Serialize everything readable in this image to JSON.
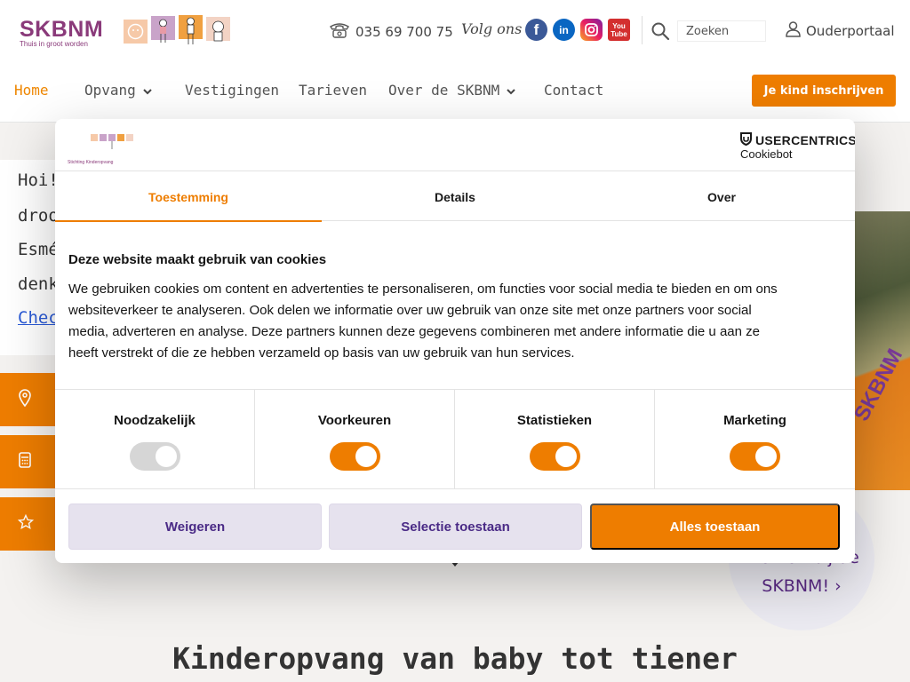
{
  "brand": {
    "name": "SKBNM",
    "tagline": "Thuis in groot worden"
  },
  "contact": {
    "phone": "035 69 700 75",
    "follow_label": "Volg ons"
  },
  "social": {
    "facebook": "f",
    "linkedin": "in",
    "youtube_top": "You",
    "youtube_bottom": "Tube"
  },
  "search": {
    "placeholder": "Zoeken"
  },
  "portal": {
    "label": "Ouderportaal"
  },
  "nav": {
    "items": [
      {
        "label": "Home",
        "active": true
      },
      {
        "label": "Opvang",
        "dropdown": true
      },
      {
        "label": "Vestigingen"
      },
      {
        "label": "Tarieven"
      },
      {
        "label": "Over de SKBNM",
        "dropdown": true
      },
      {
        "label": "Contact"
      }
    ],
    "cta": "Je kind inschrijven"
  },
  "hero": {
    "lines": [
      "Hoi!",
      "droo",
      "Esmé",
      "denk"
    ],
    "link": "Chec",
    "photo_brand": "SKBNM"
  },
  "jobs_bubble": {
    "line1": "Werken bij de",
    "line2": "SKBNM! ›"
  },
  "page": {
    "heading": "Kinderopvang van baby tot tiener"
  },
  "cookie_modal": {
    "logo_text": "Stichting Kinderopvang",
    "provider_title": "USERCENTRICS",
    "provider_sub": "Cookiebot",
    "tabs": [
      "Toestemming",
      "Details",
      "Over"
    ],
    "active_tab": "Toestemming",
    "heading": "Deze website maakt gebruik van cookies",
    "text_lines": [
      "We gebruiken cookies om content en advertenties te personaliseren, om functies voor social media te bieden en om ons",
      "websiteverkeer te analyseren. Ook delen we informatie over uw gebruik van onze site met onze partners voor social",
      "media, adverteren en analyse. Deze partners kunnen deze gegevens combineren met andere informatie die u aan ze",
      "heeft verstrekt of die ze hebben verzameld op basis van uw gebruik van hun services."
    ],
    "categories": [
      {
        "label": "Noodzakelijk",
        "enabled": true,
        "locked": true
      },
      {
        "label": "Voorkeuren",
        "enabled": true
      },
      {
        "label": "Statistieken",
        "enabled": true
      },
      {
        "label": "Marketing",
        "enabled": true
      }
    ],
    "buttons": {
      "reject": "Weigeren",
      "selection": "Selectie toestaan",
      "accept_all": "Alles toestaan"
    }
  },
  "colors": {
    "accent": "#ee7d00",
    "brand_purple": "#8a3a7a",
    "button_purple": "#4a2a86"
  }
}
